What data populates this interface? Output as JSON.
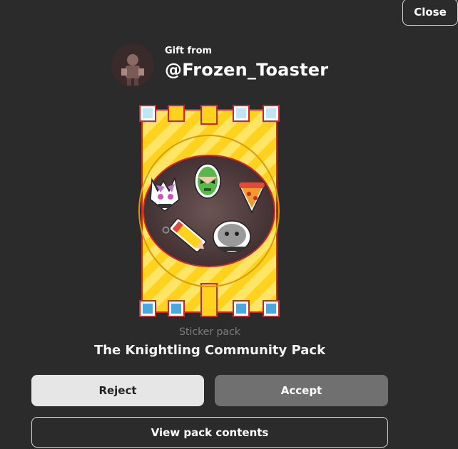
{
  "dialog": {
    "close_label": "Close",
    "gift_from_label": "Gift from",
    "sender_username": "@Frozen_Toaster"
  },
  "pack": {
    "type_label": "Sticker pack",
    "name": "The Knightling Community Pack",
    "art_icon": "castle-sticker-pack-art"
  },
  "actions": {
    "reject_label": "Reject",
    "accept_label": "Accept",
    "view_contents_label": "View pack contents"
  },
  "colors": {
    "background": "#2b2b2b",
    "reject_bg": "#e6e6e6",
    "accept_bg": "#707070",
    "pack_gold": "#ffd21e",
    "pack_border": "#d2232a"
  }
}
